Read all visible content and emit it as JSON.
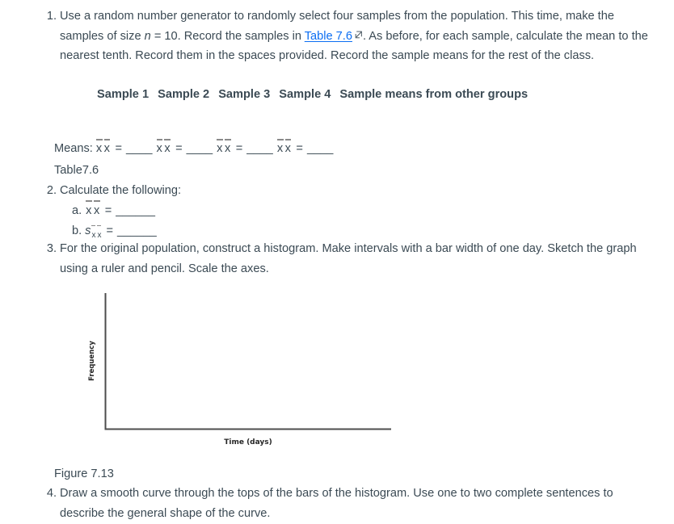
{
  "exercise": {
    "items": [
      {
        "marker": "1.",
        "text_before_link": "Use a random number generator to randomly select four samples from the population. This time, make the samples of size ",
        "italic_n": "n",
        "text_eq": " = 10. Record the samples in ",
        "link_label": "Table 7.6",
        "link_icon": "external-link-icon",
        "text_after_link": ". As before, for each sample, calculate the mean to the nearest tenth. Record them in the spaces provided. Record the sample means for the rest of the class."
      },
      {
        "marker": "2.",
        "text": "Calculate the following:"
      },
      {
        "marker": "3.",
        "text": "For the original population, construct a histogram. Make intervals with a bar width of one day. Sketch the graph using a ruler and pencil. Scale the axes."
      },
      {
        "marker": "4.",
        "text": "Draw a smooth curve through the tops of the bars of the histogram. Use one to two complete sentences to describe the general shape of the curve."
      }
    ]
  },
  "sample_table": {
    "headers": [
      "Sample 1",
      "Sample 2",
      "Sample 3",
      "Sample 4",
      "Sample means from other groups"
    ]
  },
  "means_row": {
    "label": "Means:",
    "xbar": "x̄x̄",
    "equals": "=",
    "blank": "____",
    "count": 4
  },
  "table_caption": "Table7.6",
  "calculations": [
    {
      "marker": "a.",
      "symbol": "x̄x̄",
      "subscript": "",
      "equals": "=",
      "blank": "______"
    },
    {
      "marker": "b.",
      "symbol": "s",
      "subscript": "x̄x̄",
      "equals": "=",
      "blank": "______"
    }
  ],
  "figure": {
    "caption": "Figure 7.13",
    "axis_color": "#4d4d4d"
  },
  "chart_data": {
    "type": "bar",
    "title": "",
    "xlabel": "Time (days)",
    "ylabel": "Frequency",
    "categories": [],
    "values": [],
    "grid": false,
    "legend": false,
    "note": "Empty axes template for a hand-drawn histogram; no bars, no tick labels, no gridlines."
  }
}
